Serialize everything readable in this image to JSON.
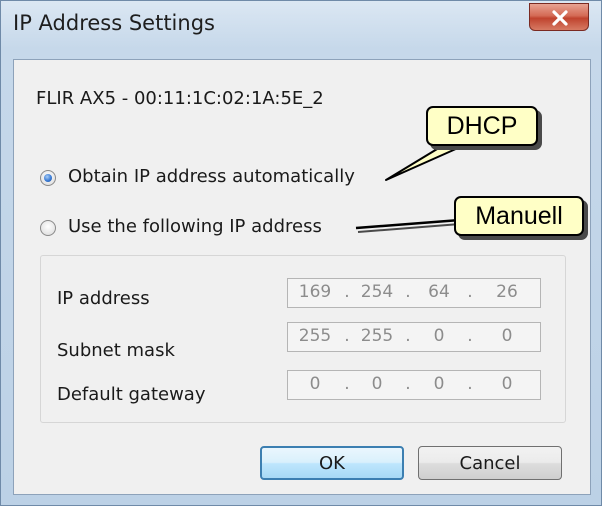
{
  "window": {
    "title": "IP Address Settings",
    "close_icon": "close-icon"
  },
  "device_label": "FLIR AX5 - 00:11:1C:02:1A:5E_2",
  "options": [
    {
      "label": "Obtain IP address automatically",
      "selected": true
    },
    {
      "label": "Use the following IP address",
      "selected": false
    }
  ],
  "fields": [
    {
      "label": "IP address",
      "octets": [
        "169",
        "254",
        "64",
        "26"
      ]
    },
    {
      "label": "Subnet mask",
      "octets": [
        "255",
        "255",
        "0",
        "0"
      ]
    },
    {
      "label": "Default gateway",
      "octets": [
        "0",
        "0",
        "0",
        "0"
      ]
    }
  ],
  "buttons": {
    "ok": "OK",
    "cancel": "Cancel"
  },
  "annotations": {
    "dhcp": "DHCP",
    "manual": "Manuell"
  },
  "colors": {
    "callout_fill": "#ffffc6",
    "ok_border": "#3c7fb1",
    "radio_selected": "#3a7bd5",
    "close_button": "#c0432e"
  }
}
